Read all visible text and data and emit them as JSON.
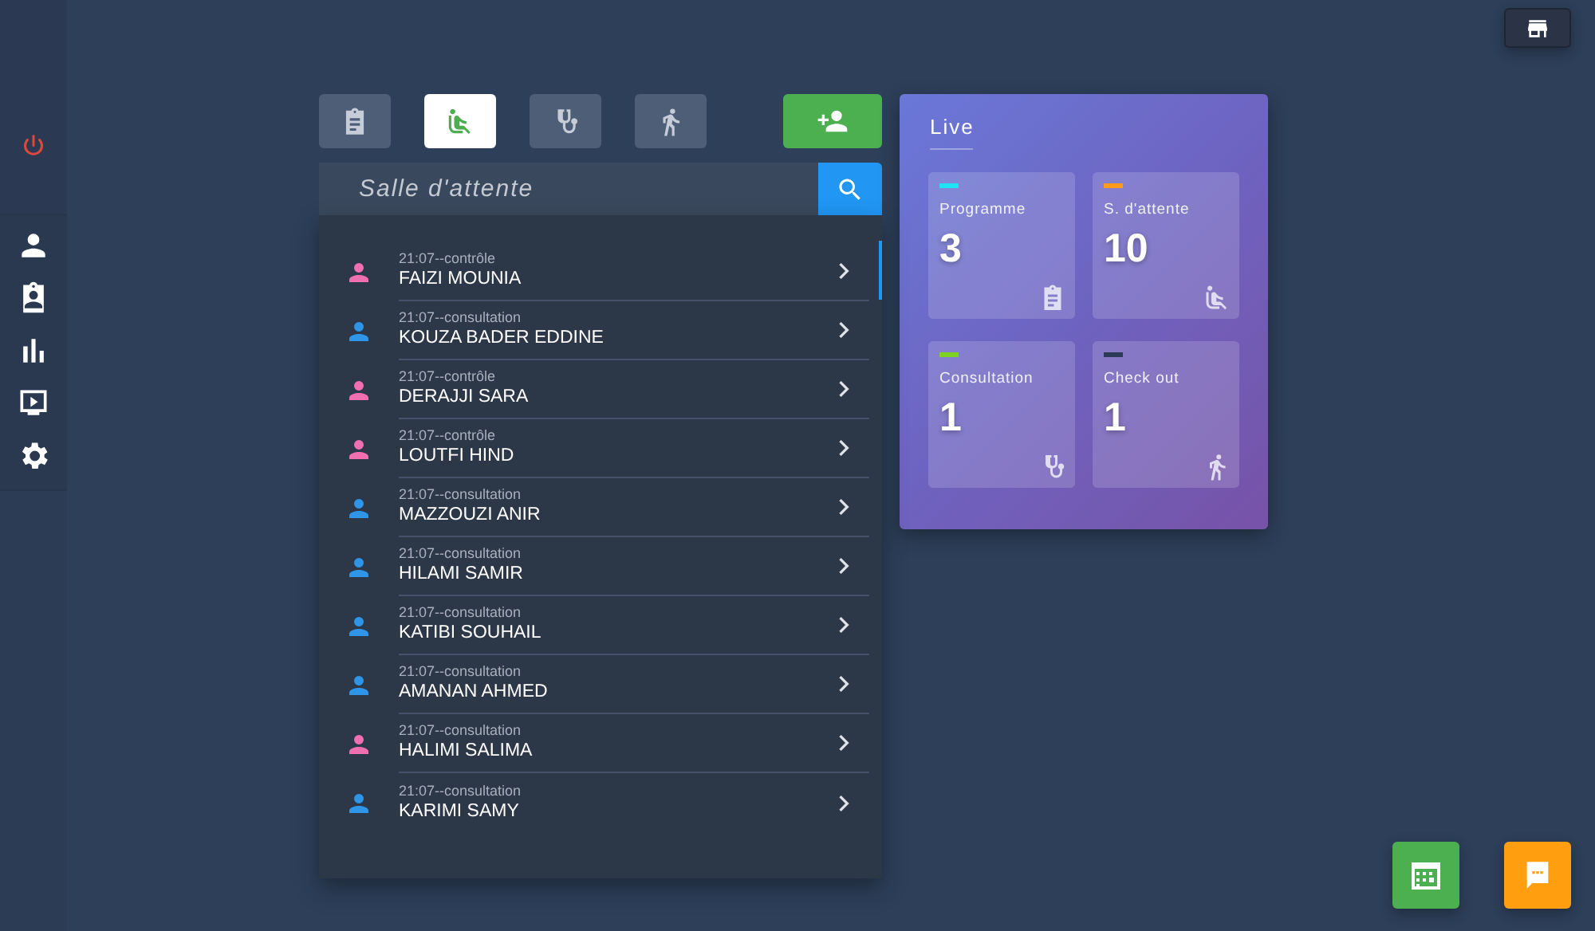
{
  "tabs": [
    {
      "kind": "clipboard",
      "selected": false
    },
    {
      "kind": "seat",
      "selected": true
    },
    {
      "kind": "stethoscope",
      "selected": false
    },
    {
      "kind": "runner",
      "selected": false
    }
  ],
  "search": {
    "placeholder": "Salle d'attente"
  },
  "patients": [
    {
      "time": "21:07--contrôle",
      "name": "FAIZI MOUNIA",
      "color": "#f06fb0"
    },
    {
      "time": "21:07--consultation",
      "name": "KOUZA BADER EDDINE",
      "color": "#2f95e8"
    },
    {
      "time": "21:07--contrôle",
      "name": "DERAJJI SARA",
      "color": "#f06fb0"
    },
    {
      "time": "21:07--contrôle",
      "name": "LOUTFI HIND",
      "color": "#f06fb0"
    },
    {
      "time": "21:07--consultation",
      "name": "MAZZOUZI ANIR",
      "color": "#2f95e8"
    },
    {
      "time": "21:07--consultation",
      "name": "HILAMI SAMIR",
      "color": "#2f95e8"
    },
    {
      "time": "21:07--consultation",
      "name": "KATIBI SOUHAIL",
      "color": "#2f95e8"
    },
    {
      "time": "21:07--consultation",
      "name": "AMANAN AHMED",
      "color": "#2f95e8"
    },
    {
      "time": "21:07--consultation",
      "name": "HALIMI SALIMA",
      "color": "#f06fb0"
    },
    {
      "time": "21:07--consultation",
      "name": "KARIMI SAMY",
      "color": "#2f95e8"
    }
  ],
  "live": {
    "title": "Live",
    "cards": [
      {
        "label": "Programme",
        "count": "3",
        "kind": "clipboard",
        "color": "#1ee3f5"
      },
      {
        "label": "S. d'attente",
        "count": "10",
        "kind": "seat",
        "color": "#ff9a1a"
      },
      {
        "label": "Consultation",
        "count": "1",
        "kind": "stethoscope",
        "color": "#7ed321"
      },
      {
        "label": "Check out",
        "count": "1",
        "kind": "runner",
        "color": "#2c3a55"
      }
    ]
  }
}
